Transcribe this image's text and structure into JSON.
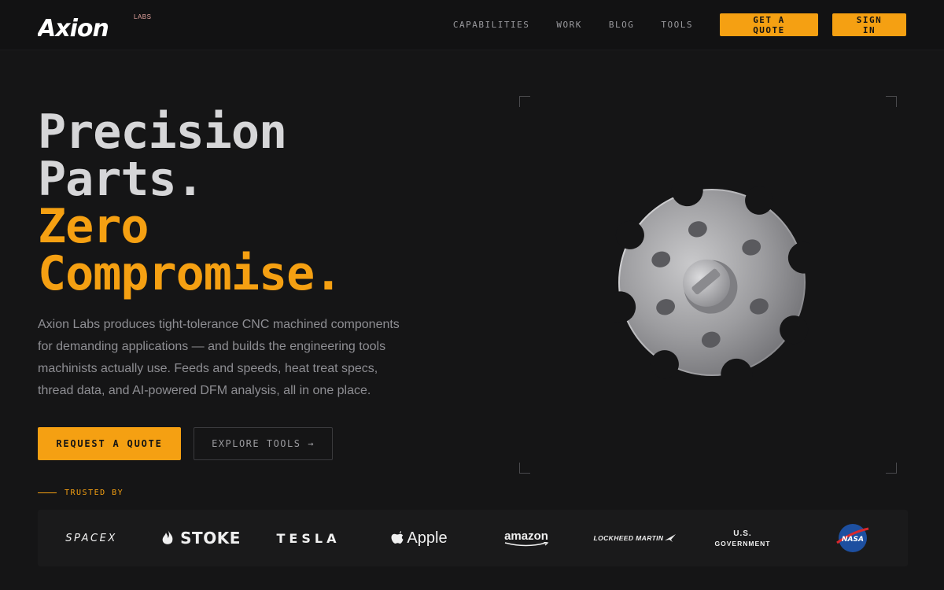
{
  "brand": {
    "name": "Axion",
    "sub": "LABS"
  },
  "nav": {
    "links": [
      "CAPABILITIES",
      "WORK",
      "BLOG",
      "TOOLS"
    ],
    "quote_label": "GET A QUOTE",
    "signin_label": "SIGN IN"
  },
  "hero": {
    "line1": "Precision",
    "line2": "Parts.",
    "line3": "Zero",
    "line4": "Compromise.",
    "description": "Axion Labs produces tight-tolerance CNC machined components for demanding applications — and builds the engineering tools machinists actually use. Feeds and speeds, heat treat specs, thread data, and AI-powered DFM analysis, all in one place.",
    "primary_cta": "REQUEST A QUOTE",
    "secondary_cta": "EXPLORE TOOLS →"
  },
  "trusted": {
    "label": "TRUSTED BY",
    "logos": {
      "spacex": "SPACEX",
      "stoke": "STOKE",
      "tesla": "TESLA",
      "apple": "Apple",
      "amazon": "amazon",
      "lockheed": "LOCKHEED MARTIN",
      "usgov_1": "U.S.",
      "usgov_2": "GOVERNMENT",
      "nasa": "NASA"
    }
  },
  "colors": {
    "accent": "#f5a012",
    "background": "#151516",
    "header": "#121213",
    "text_muted": "#8e8e93"
  }
}
